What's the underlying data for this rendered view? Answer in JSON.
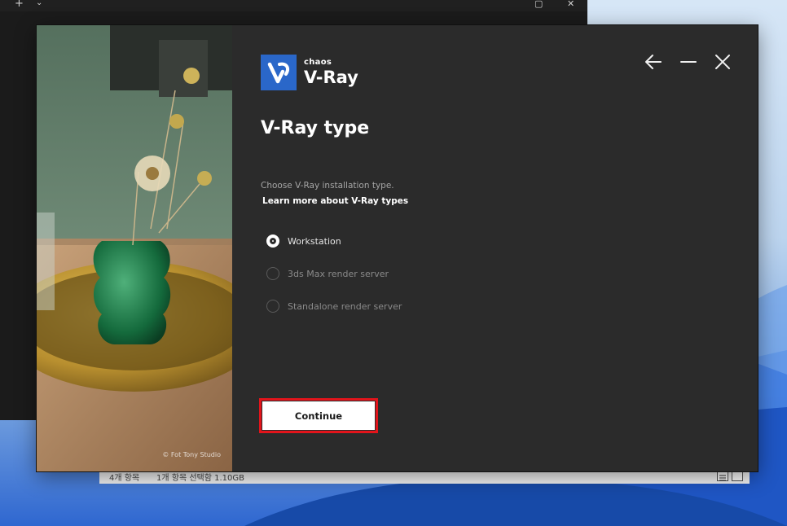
{
  "background_window": {
    "titlebar_new_tab": "+",
    "titlebar_dropdown": "⌄",
    "titlebar_maximize": "▢",
    "titlebar_close": "✕",
    "status_items": "4개 항목",
    "status_selected": "1개 항목 선택함 1.10GB"
  },
  "installer": {
    "brand": {
      "company": "chaos",
      "product": "V-Ray",
      "accent_color": "#2a67c9"
    },
    "window_controls": [
      "back-icon",
      "minimize-icon",
      "close-icon"
    ],
    "title": "V-Ray type",
    "description": "Choose V-Ray installation type.",
    "learn_more": "Learn more about V-Ray types",
    "options": [
      {
        "label": "Workstation",
        "selected": true
      },
      {
        "label": "3ds Max render server",
        "selected": false
      },
      {
        "label": "Standalone render server",
        "selected": false
      }
    ],
    "continue_label": "Continue",
    "highlight_color": "#e3141b",
    "photo_credit": "© Fot Tony Studio"
  }
}
